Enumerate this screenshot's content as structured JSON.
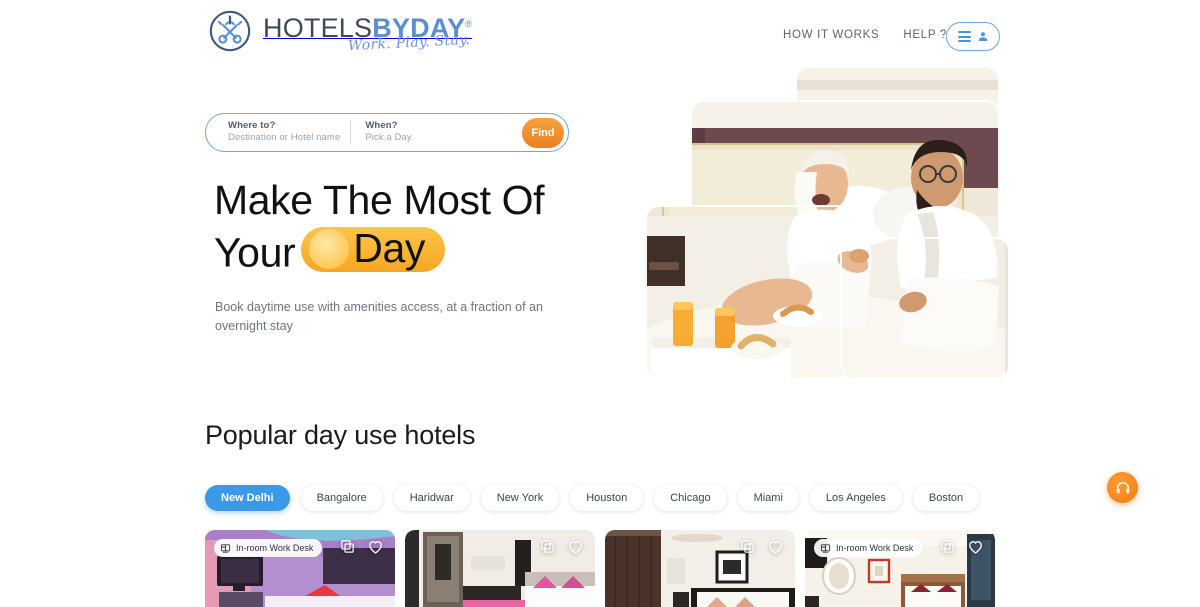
{
  "brand": {
    "name_part1": "HOTELS",
    "name_part2": "BY",
    "name_part3": "DAY",
    "registered": "®",
    "tagline": "Work. Play. Stay.",
    "logo_icon": "crossed-keys-circle-icon",
    "color": "#5b8fd4"
  },
  "header": {
    "nav": [
      {
        "label": "HOW IT WORKS"
      },
      {
        "label": "HELP ?"
      }
    ],
    "language_icon": "globe-icon",
    "menu_icon": "hamburger-icon",
    "account_icon": "user-avatar-icon"
  },
  "search": {
    "where_label": "Where to?",
    "where_placeholder": "Destination or Hotel name",
    "when_label": "When?",
    "when_placeholder": "Pick a Day",
    "find_label": "Find",
    "find_color": "#ef8622",
    "border_color": "#6aa9e4"
  },
  "hero": {
    "title_line1": "Make The Most Of",
    "title_line2_prefix": "Your",
    "title_highlight": "Day",
    "highlight_color": "#f9bf43",
    "subtitle": "Book daytime use with amenities access, at a fraction of an overnight stay",
    "image_alt": "Couple in white bathrobes laughing on hotel bed with breakfast tray"
  },
  "popular": {
    "title": "Popular day use hotels",
    "active_tab_color": "#3b99e8",
    "tabs": [
      {
        "label": "New Delhi",
        "active": true
      },
      {
        "label": "Bangalore",
        "active": false
      },
      {
        "label": "Haridwar",
        "active": false
      },
      {
        "label": "New York",
        "active": false
      },
      {
        "label": "Houston",
        "active": false
      },
      {
        "label": "Chicago",
        "active": false
      },
      {
        "label": "Miami",
        "active": false
      },
      {
        "label": "Los Angeles",
        "active": false
      },
      {
        "label": "Boston",
        "active": false
      }
    ],
    "cards": [
      {
        "badge": "In-room Work Desk",
        "has_badge": true,
        "gallery_icon": "gallery-icon",
        "favorite_icon": "heart-icon"
      },
      {
        "badge": "",
        "has_badge": false,
        "gallery_icon": "gallery-icon",
        "favorite_icon": "heart-icon"
      },
      {
        "badge": "",
        "has_badge": false,
        "gallery_icon": "gallery-icon",
        "favorite_icon": "heart-icon"
      },
      {
        "badge": "In-room Work Desk",
        "has_badge": true,
        "gallery_icon": "gallery-icon",
        "favorite_icon": "heart-icon"
      }
    ]
  },
  "support": {
    "icon": "headset-support-icon",
    "color": "#f37b10"
  }
}
